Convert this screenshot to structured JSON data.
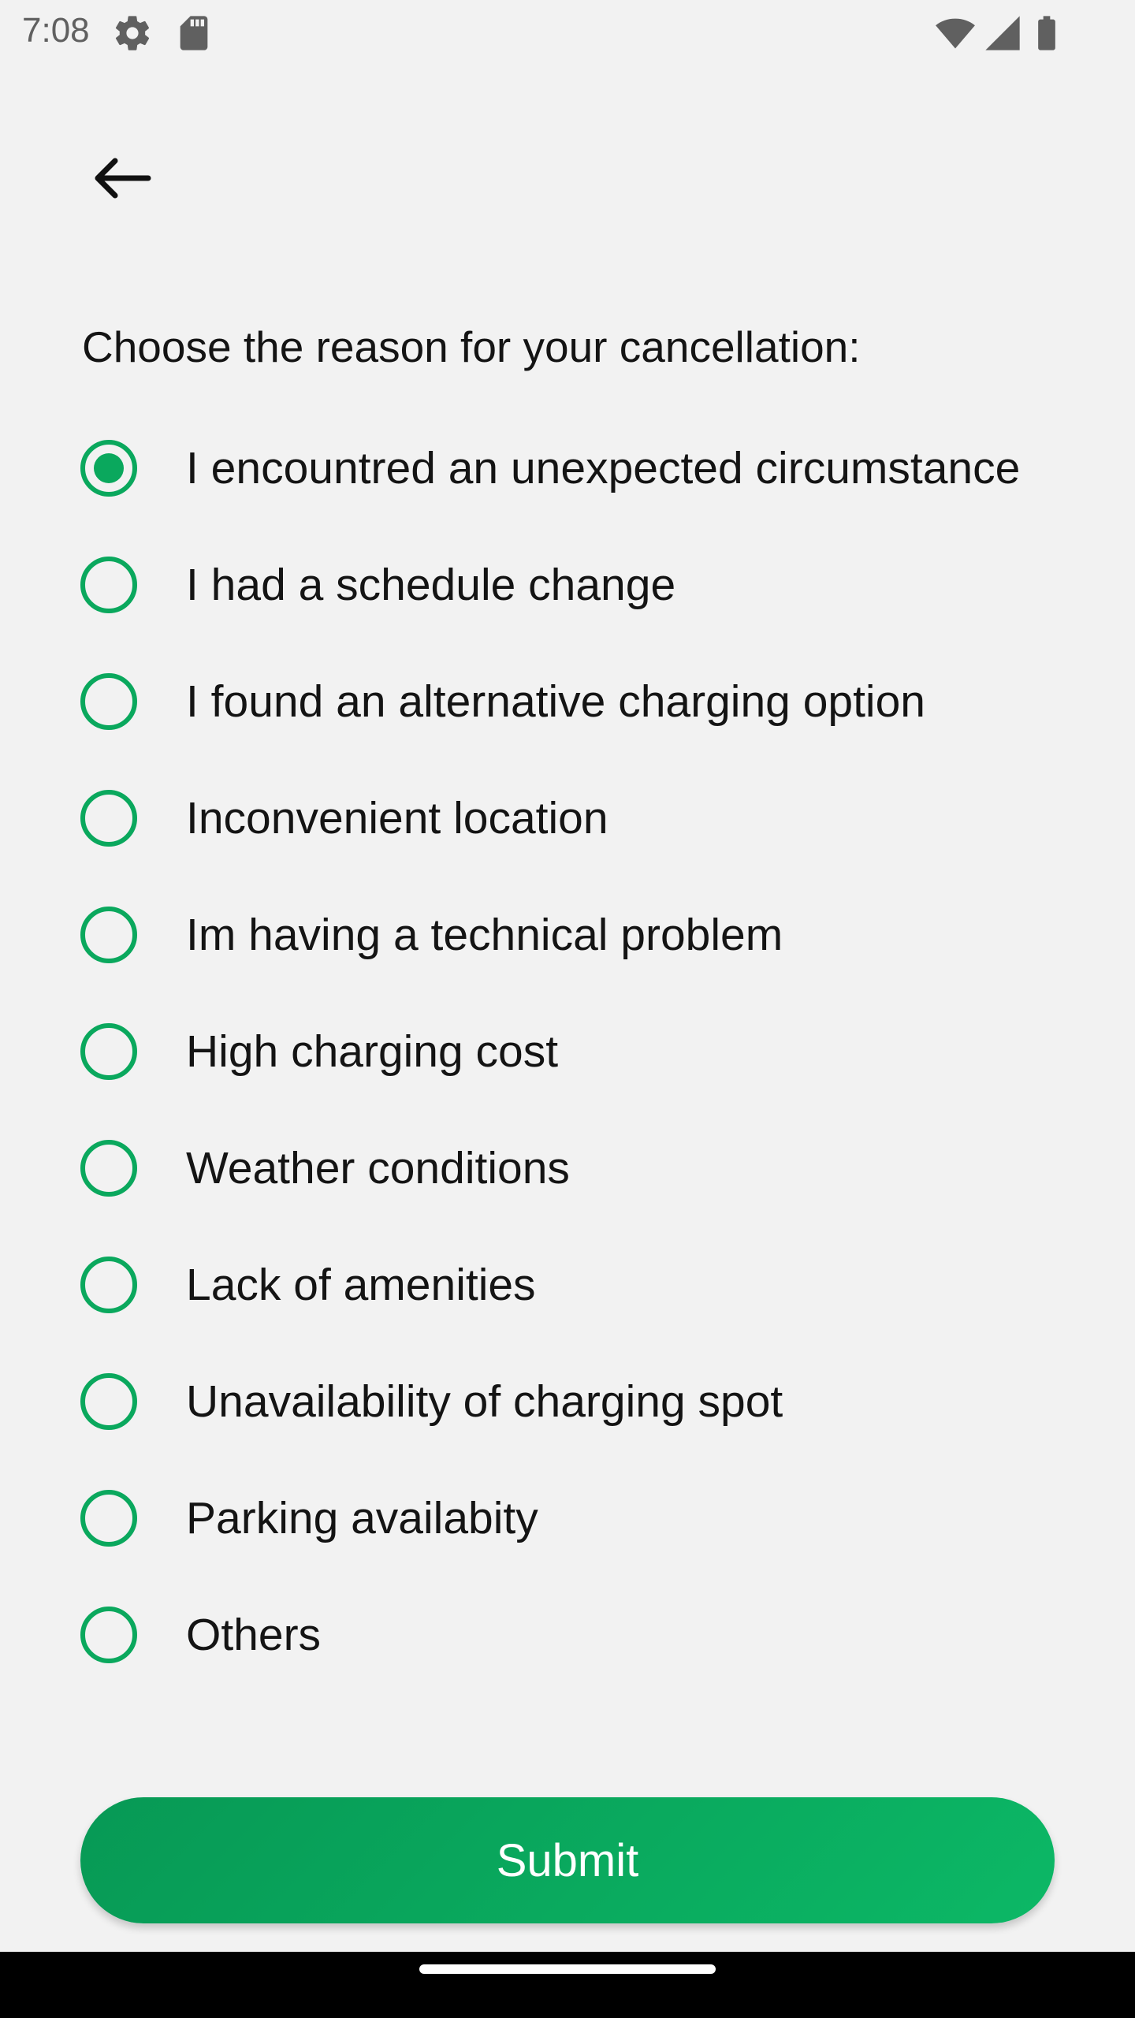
{
  "status_bar": {
    "time": "7:08",
    "left_icons": [
      "settings-icon",
      "sd-card-icon"
    ],
    "right_icons": [
      "wifi-icon",
      "cellular-signal-icon",
      "battery-icon"
    ]
  },
  "header": {
    "back_icon": "arrow-left-icon"
  },
  "form": {
    "prompt": "Choose the reason for your cancellation:",
    "selected_index": 0,
    "options": [
      {
        "label": "I encountred an unexpected circumstance",
        "checked": true
      },
      {
        "label": "I had a schedule change",
        "checked": false
      },
      {
        "label": "I found an alternative charging option",
        "checked": false
      },
      {
        "label": "Inconvenient location",
        "checked": false
      },
      {
        "label": "Im having a technical problem",
        "checked": false
      },
      {
        "label": "High charging cost",
        "checked": false
      },
      {
        "label": "Weather conditions",
        "checked": false
      },
      {
        "label": "Lack of amenities",
        "checked": false
      },
      {
        "label": "Unavailability of charging spot",
        "checked": false
      },
      {
        "label": "Parking availabity",
        "checked": false
      },
      {
        "label": "Others",
        "checked": false
      }
    ],
    "submit_label": "Submit"
  },
  "colors": {
    "accent": "#0aa85d",
    "background": "#f2f2f2",
    "text": "#141414",
    "button_text": "#ffffff"
  }
}
